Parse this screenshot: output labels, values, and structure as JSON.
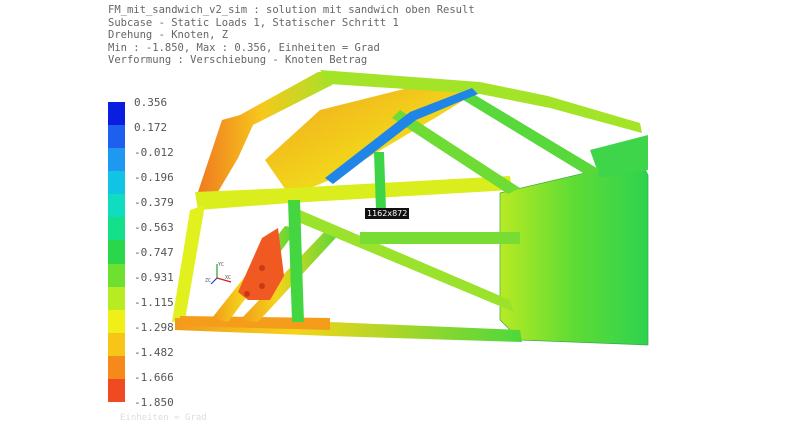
{
  "header": {
    "lines": [
      "FM_mit_sandwich_v2_sim : solution mit sandwich oben Result",
      "Subcase - Static Loads 1, Statischer Schritt 1",
      "Drehung - Knoten, Z",
      "Min : -1.850, Max : 0.356, Einheiten = Grad",
      "Verformung : Verschiebung - Knoten Betrag"
    ]
  },
  "legend": {
    "ticks": [
      "0.356",
      "0.172",
      "-0.012",
      "-0.196",
      "-0.379",
      "-0.563",
      "-0.747",
      "-0.931",
      "-1.115",
      "-1.298",
      "-1.482",
      "-1.666",
      "-1.850"
    ],
    "colors": [
      "#0a1ee0",
      "#1f5ff0",
      "#1f98f0",
      "#11c4e6",
      "#10ddc0",
      "#14e08a",
      "#2ad64a",
      "#6ee030",
      "#b8ec22",
      "#f0f018",
      "#f7c418",
      "#f58a1a",
      "#f04a22"
    ]
  },
  "viewport": {
    "size_tag": "1162x872",
    "triad_labels": [
      "YC",
      "ZC",
      "XC"
    ],
    "footer_label": "Einheiten = Grad"
  }
}
